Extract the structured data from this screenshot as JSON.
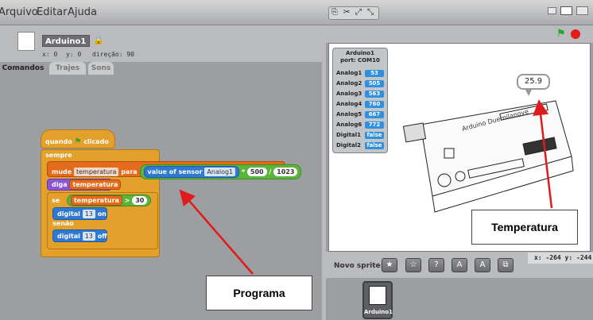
{
  "menu": {
    "file": "Arquivo",
    "edit": "Editar",
    "help": "Ajuda"
  },
  "sprite": {
    "name": "Arduino1",
    "x_label": "x: 0",
    "y_label": "y: 0",
    "direction_label": "direção: 90"
  },
  "tabs": {
    "commands": "Comandos",
    "costumes": "Trajes",
    "sounds": "Sons"
  },
  "script": {
    "hat": "quando",
    "hat_suffix": "clicado",
    "forever": "sempre",
    "set_label": "mude",
    "set_var": "temperatura",
    "set_to": "para",
    "sensor_label": "value of sensor",
    "sensor_name": "Analog1",
    "mult": "*",
    "num1": "500",
    "div": "/",
    "num2": "1023",
    "say_label": "diga",
    "say_var": "temperatura",
    "if_label": "se",
    "cond_var": "temperatura",
    "cond_op": ">",
    "cond_val": "30",
    "digital1_label": "digital",
    "digital1_pin": "13",
    "digital1_state": "on",
    "else_label": "senão",
    "digital2_label": "digital",
    "digital2_pin": "13",
    "digital2_state": "off"
  },
  "sensor_board": {
    "title": "Arduino1",
    "port": "port: COM10",
    "rows": [
      {
        "name": "Analog1",
        "value": "53"
      },
      {
        "name": "Analog2",
        "value": "505"
      },
      {
        "name": "Analog3",
        "value": "563"
      },
      {
        "name": "Analog4",
        "value": "760"
      },
      {
        "name": "Analog5",
        "value": "667"
      },
      {
        "name": "Analog6",
        "value": "772"
      },
      {
        "name": "Digital1",
        "value": "false"
      },
      {
        "name": "Digital2",
        "value": "false"
      }
    ]
  },
  "stage": {
    "bubble": "25.9",
    "board_text": "Arduino Duemilanove"
  },
  "sprite_bar": {
    "label": "Novo sprite:",
    "mouse_x": "x: -264",
    "mouse_y": "y: -244"
  },
  "sprite_thumb_label": "Arduino1",
  "callouts": {
    "temp": "Temperatura",
    "program": "Programa"
  },
  "colors": {
    "accent_red": "#e01b1b",
    "control": "#e3a12c",
    "variables": "#e46b1c",
    "sensing": "#2f7ad0",
    "looks": "#8a55d7",
    "operators": "#5cb53b"
  },
  "icons": [
    "green-flag-icon",
    "stop-icon",
    "lock-icon",
    "view-small-icon",
    "view-normal-icon",
    "presentation-icon",
    "paint-sprite-icon",
    "star-sprite-icon",
    "random-sprite-icon",
    "grow-icon",
    "shrink-icon",
    "duplicate-icon",
    "cut-icon"
  ]
}
